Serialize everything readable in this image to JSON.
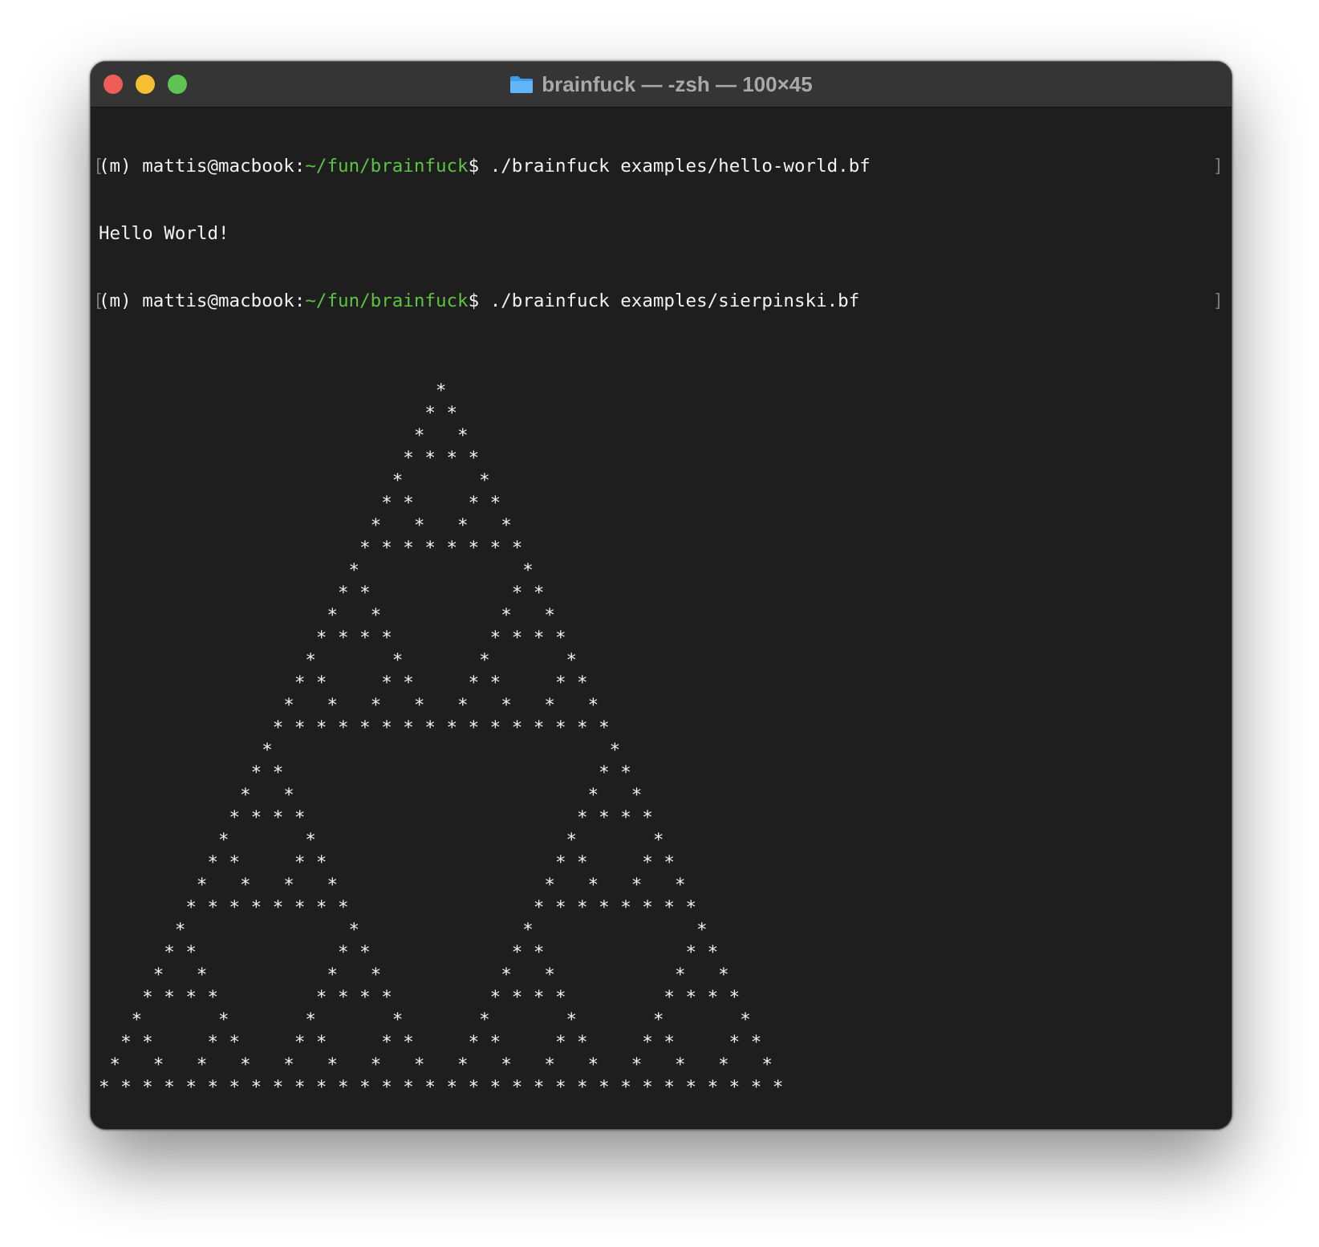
{
  "window": {
    "title": "brainfuck — -zsh — 100×45",
    "title_icon": "folder-icon"
  },
  "colors": {
    "terminal_bg": "#1e1e1e",
    "text": "#f2f2f2",
    "path_green": "#5bc440",
    "close": "#ee5e57",
    "minimize": "#f5be33",
    "zoom": "#5fc454"
  },
  "prompt": {
    "env": "(m) ",
    "user_host": "mattis@macbook:",
    "path": "~/fun/brainfuck",
    "symbol": "$ "
  },
  "commands": [
    {
      "command": "./brainfuck examples/hello-world.bf",
      "output": "Hello World!"
    },
    {
      "command": "./brainfuck examples/sierpinski.bf"
    }
  ],
  "sierpinski": [
    "                               *",
    "                              * *",
    "                             *   *",
    "                            * * * *",
    "                           *       *",
    "                          * *     * *",
    "                         *   *   *   *",
    "                        * * * * * * * *",
    "                       *               *",
    "                      * *             * *",
    "                     *   *           *   *",
    "                    * * * *         * * * *",
    "                   *       *       *       *",
    "                  * *     * *     * *     * *",
    "                 *   *   *   *   *   *   *   *",
    "                * * * * * * * * * * * * * * * *",
    "               *                               *",
    "              * *                             * *",
    "             *   *                           *   *",
    "            * * * *                         * * * *",
    "           *       *                       *       *",
    "          * *     * *                     * *     * *",
    "         *   *   *   *                   *   *   *   *",
    "        * * * * * * * *                 * * * * * * * *",
    "       *               *               *               *",
    "      * *             * *             * *             * *",
    "     *   *           *   *           *   *           *   *",
    "    * * * *         * * * *         * * * *         * * * *",
    "   *       *       *       *       *       *       *       *",
    "  * *     * *     * *     * *     * *     * *     * *     * *",
    " *   *   *   *   *   *   *   *   *   *   *   *   *   *   *   *",
    "* * * * * * * * * * * * * * * * * * * * * * * * * * * * * * * *"
  ]
}
